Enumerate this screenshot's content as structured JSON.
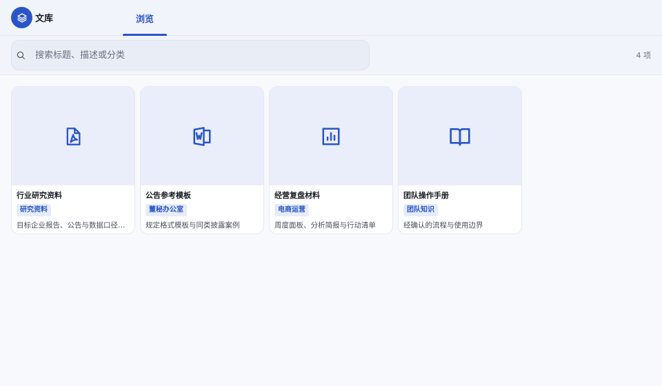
{
  "header": {
    "brand_name": "文库",
    "brand_icon": "layers-icon",
    "tabs": [
      {
        "label": "浏览",
        "active": true
      }
    ]
  },
  "search": {
    "placeholder": "搜索标题、描述或分类",
    "value": "",
    "icon": "search-icon"
  },
  "result_count": "4 项",
  "colors": {
    "accent": "#2a55c9",
    "thumb_bg": "#e9eefa",
    "tag_bg": "#e6ecfa"
  },
  "cards": [
    {
      "title": "行业研究资料",
      "tag": "研究资料",
      "desc": "目标企业报告、公告与数据口径说明",
      "icon": "pdf-file-icon"
    },
    {
      "title": "公告参考模板",
      "tag": "董秘办公室",
      "desc": "规定格式模板与同类披露案例",
      "icon": "word-file-icon"
    },
    {
      "title": "经营复盘材料",
      "tag": "电商运营",
      "desc": "周度面板、分析简报与行动清单",
      "icon": "bar-chart-icon"
    },
    {
      "title": "团队操作手册",
      "tag": "团队知识",
      "desc": "经确认的流程与使用边界",
      "icon": "book-icon"
    }
  ]
}
